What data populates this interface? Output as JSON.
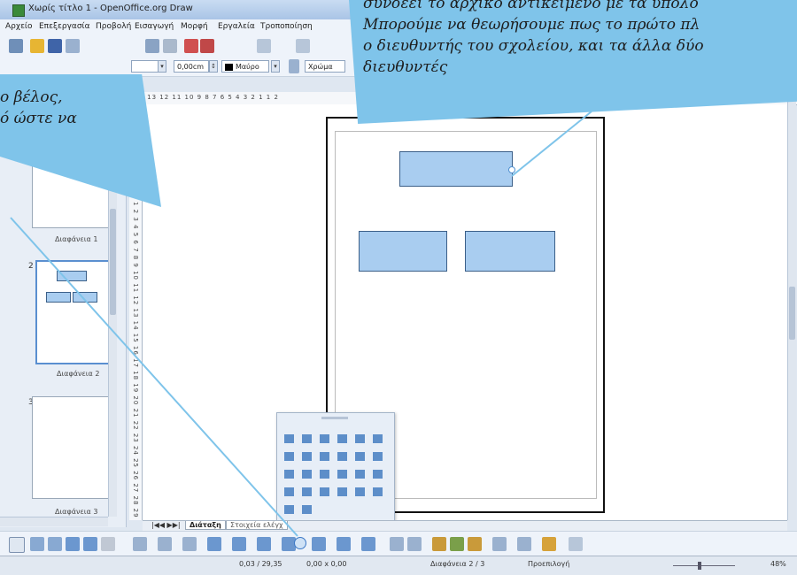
{
  "window": {
    "title": "Χωρίς τίτλο 1 - OpenOffice.org Draw"
  },
  "menubar": {
    "items": [
      "Αρχείο",
      "Επεξεργασία",
      "Προβολή",
      "Εισαγωγή",
      "Μορφή",
      "Εργαλεία",
      "Τροποποίηση"
    ]
  },
  "toolbar2": {
    "line_width": "0,00cm",
    "color": "Μαύρο",
    "area_style": "Χρώμα"
  },
  "rulers": {
    "horizontal": "14 13 12 11 10 9 8 7 6 5 4 3 2 1 1 2",
    "vertical": "1 2 3 4 5 6 7 8 9 10 11 12 13 14 15 16 17 18 19 20 21 22 23 24 25 26 27 28 29"
  },
  "slides": [
    {
      "number": "",
      "label": "Διαφάνεια 1"
    },
    {
      "number": "2",
      "label": "Διαφάνεια 2"
    },
    {
      "number": "3",
      "label": "Διαφάνεια 3"
    }
  ],
  "tabs": {
    "layout": "Διάταξη",
    "controls": "Στοιχεία ελέγχ"
  },
  "statusbar": {
    "position": "0,03 / 29,35",
    "size": "0,00 x 0,00",
    "slide": "Διαφάνεια 2 / 3",
    "layout": "Προεπιλογή",
    "zoom": "48%"
  },
  "callouts": {
    "right_lines": [
      "συνδέει το αρχικό αντικείμενο με τα υπόλο",
      "Μπορούμε να θεωρήσουμε πως το πρώτο πλ",
      "ο διευθυντής του σχολείου, και τα άλλα δύο",
      "διευθυντές"
    ],
    "left_lines": [
      "ο βέλος,",
      "ό ώστε να"
    ]
  },
  "colors": {
    "callout": "#7fc4ea",
    "shape_fill": "#a9cdf0",
    "shape_border": "#3b5f88"
  }
}
